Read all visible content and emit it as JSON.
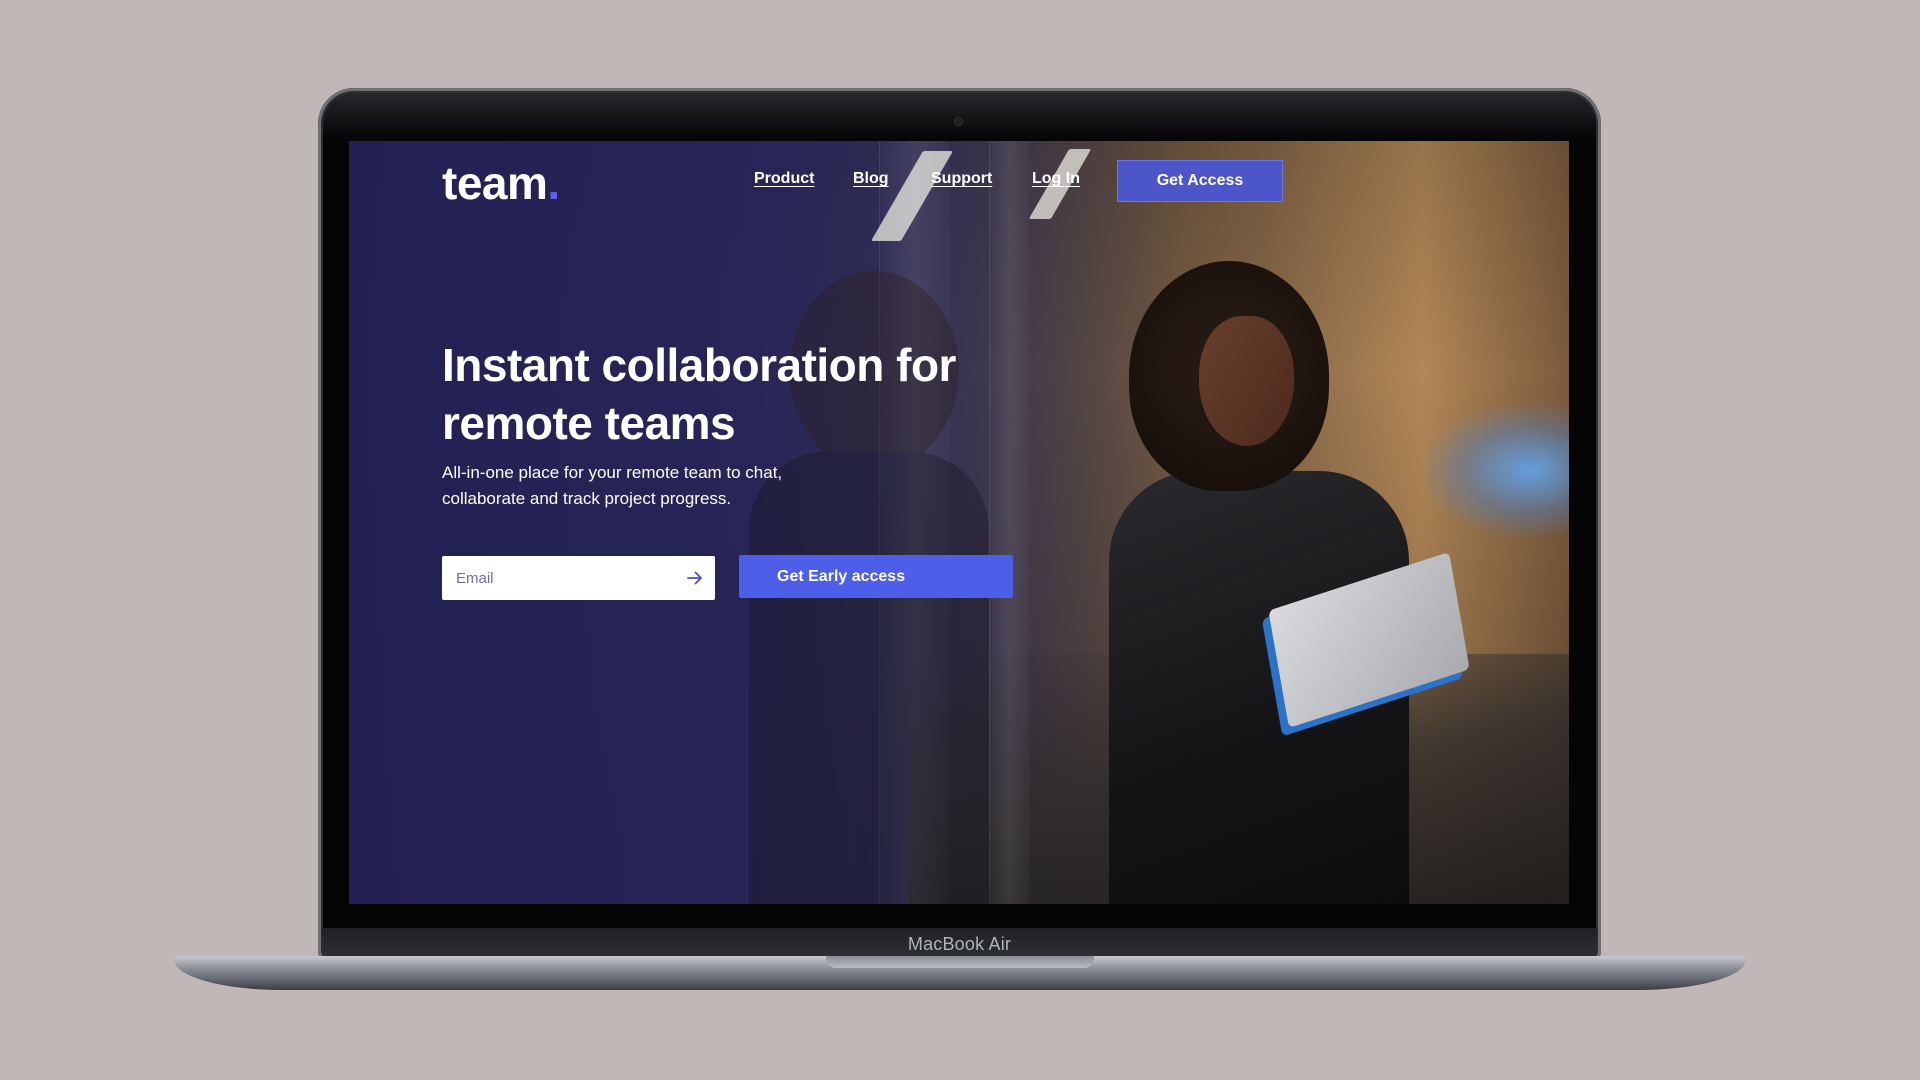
{
  "device": {
    "model_label": "MacBook Air"
  },
  "brand": {
    "logo_text": "team",
    "logo_dot": ".",
    "accent_color": "#5b63e8",
    "button_color": "#4d5ee8",
    "background_color": "#232054"
  },
  "nav": {
    "links": [
      {
        "label": "Product"
      },
      {
        "label": "Blog"
      },
      {
        "label": "Support"
      },
      {
        "label": "Log In"
      }
    ],
    "cta_label": "Get Access"
  },
  "hero": {
    "headline": "Instant collaboration for remote teams",
    "subheadline": "All-in-one place for your remote team to chat, collaborate and track project progress.",
    "email_placeholder": "Email",
    "submit_icon": "arrow-right-icon",
    "cta_label": "Get Early access"
  }
}
